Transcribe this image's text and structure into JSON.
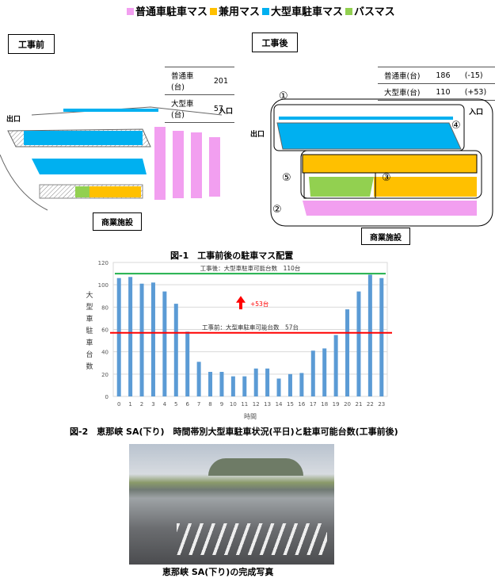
{
  "legend": [
    {
      "label": "普通車駐車マス",
      "color": "#f29ff0"
    },
    {
      "label": "兼用マス",
      "color": "#ffc000"
    },
    {
      "label": "大型車駐車マス",
      "color": "#00b0f0"
    },
    {
      "label": "バスマス",
      "color": "#92d050"
    }
  ],
  "before": {
    "title": "工事前",
    "table": [
      {
        "label": "普通車(台)",
        "value": "201"
      },
      {
        "label": "大型車(台)",
        "value": "57"
      }
    ],
    "exit": "出口",
    "entrance": "入口",
    "facility": "商業施設"
  },
  "after": {
    "title": "工事後",
    "table": [
      {
        "label": "普通車(台)",
        "value": "186",
        "diff": "(-15)"
      },
      {
        "label": "大型車(台)",
        "value": "110",
        "diff": "(+53)"
      }
    ],
    "exit": "出口",
    "entrance": "入口",
    "facility": "商業施設",
    "markers": [
      "①",
      "②",
      "③",
      "④",
      "⑤"
    ]
  },
  "figure1_caption": "図-1　工事前後の駐車マス配置",
  "chart_data": {
    "type": "bar",
    "categories": [
      "0",
      "1",
      "2",
      "3",
      "4",
      "5",
      "6",
      "7",
      "8",
      "9",
      "10",
      "11",
      "12",
      "13",
      "14",
      "15",
      "16",
      "17",
      "18",
      "19",
      "20",
      "21",
      "22",
      "23"
    ],
    "values": [
      106,
      107,
      101,
      102,
      94,
      83,
      58,
      31,
      22,
      22,
      18,
      18,
      25,
      25,
      16,
      20,
      21,
      41,
      43,
      55,
      78,
      94,
      109,
      106
    ],
    "xlabel": "時間",
    "ylabel": "大型車駐車台数",
    "ylim": [
      0,
      120
    ],
    "yticks": [
      0,
      20,
      40,
      60,
      80,
      100,
      120
    ],
    "bar_color": "#5b9bd5",
    "grid": true,
    "reference_lines": [
      {
        "label": "工事後：大型車駐車可能台数　110台",
        "value": 110,
        "color": "#22b14c"
      },
      {
        "label": "工事前：大型車駐車可能台数　57台",
        "value": 57,
        "color": "#ff0000"
      }
    ],
    "annotation": "+53台"
  },
  "figure2_caption": "図-2　恵那峡 SA(下り)　時間帯別大型車駐車状況(平日)と駐車可能台数(工事前後)",
  "photo_caption": "恵那峡 SA(下り)の完成写真"
}
